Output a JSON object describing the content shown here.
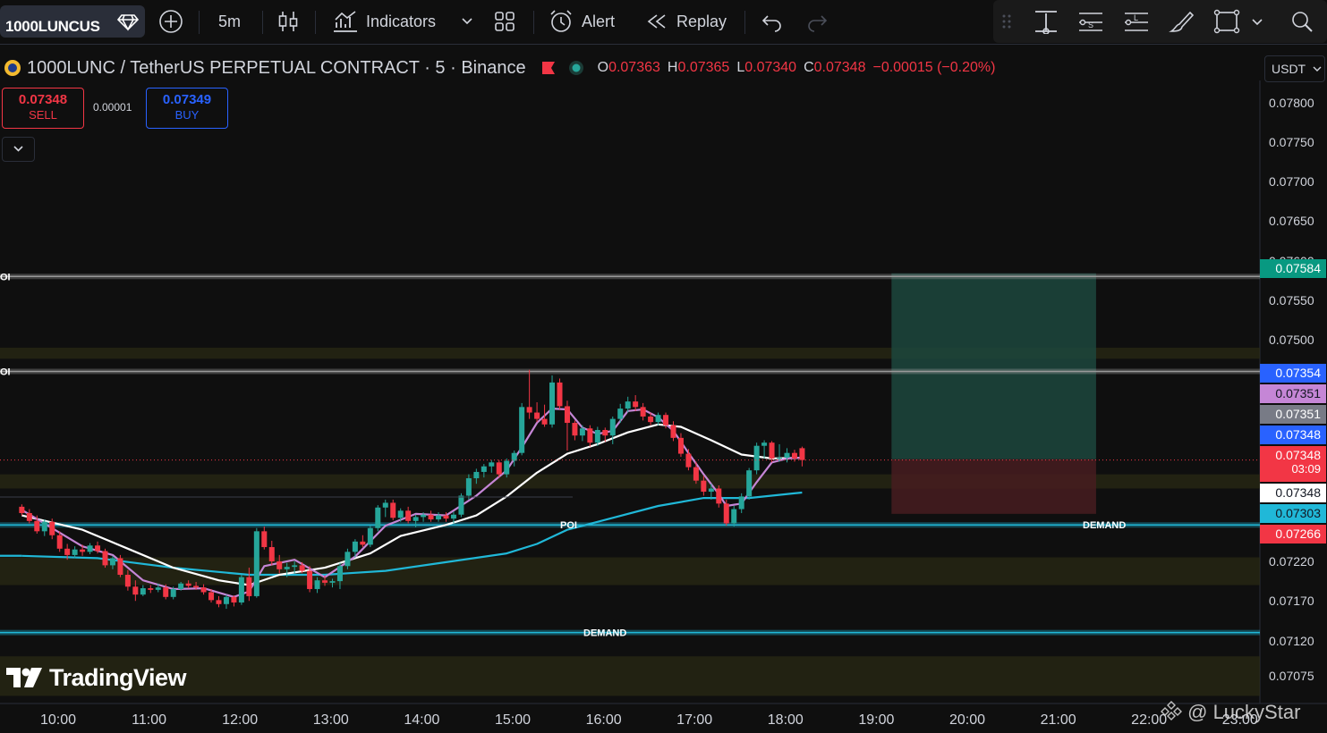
{
  "toolbar": {
    "symbol": "1000LUNCUS",
    "interval": "5m",
    "indicators_label": "Indicators",
    "alert_label": "Alert",
    "replay_label": "Replay"
  },
  "legend": {
    "title": "1000LUNC / TetherUS PERPETUAL CONTRACT · 5 · Binance",
    "open_label": "O",
    "open": "0.07363",
    "high_label": "H",
    "high": "0.07365",
    "low_label": "L",
    "low": "0.07340",
    "close_label": "C",
    "close": "0.07348",
    "change": "−0.00015 (−0.20%)"
  },
  "trade": {
    "sell_price": "0.07348",
    "sell_label": "SELL",
    "spread": "0.00001",
    "buy_price": "0.07349",
    "buy_label": "BUY"
  },
  "currency": "USDT",
  "colors": {
    "up": "#26a69a",
    "down": "#f23645",
    "ema_fast": "#c586d6",
    "ema_slow": "#ffffff",
    "ema_long": "#20b8d8",
    "profit_zone": "#1d4a40",
    "loss_zone": "#4a1d20",
    "zone_fill": "#2a2a14"
  },
  "price_tags": [
    {
      "price": "0.07584",
      "color": "#089981",
      "text_color": "#ffffff"
    },
    {
      "price": "0.07354",
      "color": "#2962ff",
      "text_color": "#ffffff"
    },
    {
      "price": "0.07351",
      "color": "#c586d6",
      "text_color": "#131722"
    },
    {
      "price": "0.07351",
      "color": "#787b86",
      "text_color": "#ffffff"
    },
    {
      "price": "0.07348",
      "color": "#2962ff",
      "text_color": "#ffffff"
    },
    {
      "price": "0.07348",
      "countdown": "03:09",
      "color": "#f23645",
      "text_color": "#ffffff"
    },
    {
      "price": "0.07348",
      "color": "#ffffff",
      "text_color": "#131722"
    },
    {
      "price": "0.07303",
      "color": "#20b8d8",
      "text_color": "#131722"
    },
    {
      "price": "0.07266",
      "color": "#f23645",
      "text_color": "#ffffff"
    }
  ],
  "annotations": {
    "poi_label": "POI",
    "poi_label_short": "OI",
    "demand_label": "DEMAND"
  },
  "watermark": "@ LuckyStar",
  "logo_text": "TradingView",
  "chart_data": {
    "type": "candlestick",
    "title": "1000LUNC / TetherUS PERPETUAL CONTRACT · 5 · Binance",
    "y_ticks": [
      "0.07800",
      "0.07750",
      "0.07700",
      "0.07650",
      "0.07600",
      "0.07550",
      "0.07500",
      "0.07220",
      "0.07170",
      "0.07120",
      "0.07075"
    ],
    "x_ticks": [
      "10:00",
      "11:00",
      "12:00",
      "13:00",
      "14:00",
      "15:00",
      "16:00",
      "17:00",
      "18:00",
      "19:00",
      "20:00",
      "21:00",
      "22:00",
      "23:00"
    ],
    "ylim": [
      0.0705,
      0.0785
    ],
    "xlim": [
      "09:36",
      "23:30"
    ],
    "candles_start": "09:36",
    "candle_interval_minutes": 5,
    "candles": [
      [
        0.07289,
        0.07292,
        0.07278,
        0.07281
      ],
      [
        0.07281,
        0.07286,
        0.07268,
        0.07271
      ],
      [
        0.07271,
        0.07278,
        0.07255,
        0.07258
      ],
      [
        0.07258,
        0.07273,
        0.07252,
        0.0727
      ],
      [
        0.0727,
        0.07274,
        0.07248,
        0.07253
      ],
      [
        0.07253,
        0.07258,
        0.07232,
        0.07236
      ],
      [
        0.07236,
        0.07242,
        0.07222,
        0.07228
      ],
      [
        0.07228,
        0.07239,
        0.07224,
        0.07235
      ],
      [
        0.07235,
        0.07241,
        0.07227,
        0.07232
      ],
      [
        0.07232,
        0.07243,
        0.07229,
        0.0724
      ],
      [
        0.0724,
        0.07245,
        0.0723,
        0.07233
      ],
      [
        0.07233,
        0.07236,
        0.07212,
        0.07215
      ],
      [
        0.07215,
        0.07227,
        0.0721,
        0.07224
      ],
      [
        0.07224,
        0.07228,
        0.072,
        0.07203
      ],
      [
        0.07203,
        0.07209,
        0.07183,
        0.07188
      ],
      [
        0.07188,
        0.07196,
        0.0717,
        0.07178
      ],
      [
        0.07178,
        0.0719,
        0.07176,
        0.07186
      ],
      [
        0.07186,
        0.0719,
        0.0718,
        0.07184
      ],
      [
        0.07184,
        0.07192,
        0.07181,
        0.07187
      ],
      [
        0.07187,
        0.07191,
        0.07172,
        0.07175
      ],
      [
        0.07175,
        0.07188,
        0.07172,
        0.07185
      ],
      [
        0.07185,
        0.07194,
        0.07183,
        0.07192
      ],
      [
        0.07192,
        0.07196,
        0.07186,
        0.07189
      ],
      [
        0.07189,
        0.07194,
        0.07184,
        0.07187
      ],
      [
        0.07187,
        0.07191,
        0.07178,
        0.07181
      ],
      [
        0.07181,
        0.07185,
        0.07168,
        0.07171
      ],
      [
        0.07171,
        0.07176,
        0.07162,
        0.07166
      ],
      [
        0.07166,
        0.07178,
        0.0716,
        0.07175
      ],
      [
        0.07175,
        0.07177,
        0.07163,
        0.07168
      ],
      [
        0.07168,
        0.07203,
        0.07165,
        0.072
      ],
      [
        0.072,
        0.07212,
        0.0717,
        0.07176
      ],
      [
        0.07176,
        0.07262,
        0.07174,
        0.07258
      ],
      [
        0.07258,
        0.07264,
        0.07235,
        0.07238
      ],
      [
        0.07238,
        0.07246,
        0.07215,
        0.0722
      ],
      [
        0.0722,
        0.07228,
        0.07205,
        0.0721
      ],
      [
        0.0721,
        0.07218,
        0.072,
        0.07213
      ],
      [
        0.07213,
        0.0722,
        0.07205,
        0.07215
      ],
      [
        0.07215,
        0.07219,
        0.07205,
        0.07208
      ],
      [
        0.07208,
        0.07214,
        0.07181,
        0.07185
      ],
      [
        0.07185,
        0.072,
        0.0718,
        0.07196
      ],
      [
        0.07196,
        0.07202,
        0.07189,
        0.07193
      ],
      [
        0.07193,
        0.07198,
        0.07187,
        0.07195
      ],
      [
        0.07195,
        0.07218,
        0.07185,
        0.07214
      ],
      [
        0.07214,
        0.07236,
        0.0721,
        0.07232
      ],
      [
        0.07232,
        0.07248,
        0.07225,
        0.07245
      ],
      [
        0.07245,
        0.07253,
        0.07238,
        0.07241
      ],
      [
        0.07241,
        0.07265,
        0.07238,
        0.07262
      ],
      [
        0.07262,
        0.07291,
        0.07258,
        0.07288
      ],
      [
        0.07288,
        0.07298,
        0.07276,
        0.07294
      ],
      [
        0.07294,
        0.07298,
        0.07272,
        0.07275
      ],
      [
        0.07275,
        0.07287,
        0.0727,
        0.07284
      ],
      [
        0.07284,
        0.07289,
        0.07268,
        0.07271
      ],
      [
        0.07271,
        0.07279,
        0.07263,
        0.07276
      ],
      [
        0.07276,
        0.07282,
        0.0727,
        0.07279
      ],
      [
        0.07279,
        0.07284,
        0.0727,
        0.07273
      ],
      [
        0.07273,
        0.07282,
        0.0727,
        0.07278
      ],
      [
        0.07278,
        0.07282,
        0.0727,
        0.07274
      ],
      [
        0.07274,
        0.07283,
        0.07268,
        0.07279
      ],
      [
        0.07279,
        0.07306,
        0.07276,
        0.07303
      ],
      [
        0.07303,
        0.0733,
        0.07298,
        0.07325
      ],
      [
        0.07325,
        0.07337,
        0.07318,
        0.07333
      ],
      [
        0.07333,
        0.07343,
        0.07326,
        0.0734
      ],
      [
        0.0734,
        0.07348,
        0.07332,
        0.07345
      ],
      [
        0.07345,
        0.07348,
        0.07326,
        0.0733
      ],
      [
        0.0733,
        0.0735,
        0.07326,
        0.07347
      ],
      [
        0.07347,
        0.0736,
        0.0734,
        0.07357
      ],
      [
        0.07357,
        0.0742,
        0.07354,
        0.07415
      ],
      [
        0.07415,
        0.07462,
        0.074,
        0.07408
      ],
      [
        0.07408,
        0.07421,
        0.07396,
        0.074
      ],
      [
        0.074,
        0.07418,
        0.0739,
        0.07393
      ],
      [
        0.07393,
        0.07455,
        0.07389,
        0.07446
      ],
      [
        0.07446,
        0.07451,
        0.07412,
        0.07416
      ],
      [
        0.07416,
        0.07423,
        0.0736,
        0.07395
      ],
      [
        0.07395,
        0.07398,
        0.07373,
        0.07379
      ],
      [
        0.07379,
        0.07392,
        0.07372,
        0.07388
      ],
      [
        0.07388,
        0.07392,
        0.07365,
        0.0737
      ],
      [
        0.0737,
        0.0739,
        0.07366,
        0.07386
      ],
      [
        0.07386,
        0.07389,
        0.07371,
        0.07379
      ],
      [
        0.07379,
        0.07403,
        0.07368,
        0.074
      ],
      [
        0.074,
        0.07419,
        0.07395,
        0.07413
      ],
      [
        0.07413,
        0.07428,
        0.07408,
        0.07422
      ],
      [
        0.07422,
        0.0743,
        0.0741,
        0.07415
      ],
      [
        0.07415,
        0.0742,
        0.07398,
        0.07403
      ],
      [
        0.07403,
        0.07408,
        0.07392,
        0.07396
      ],
      [
        0.07396,
        0.07408,
        0.07392,
        0.07405
      ],
      [
        0.07405,
        0.07408,
        0.07388,
        0.07392
      ],
      [
        0.07392,
        0.07397,
        0.07372,
        0.07376
      ],
      [
        0.07376,
        0.07382,
        0.07352,
        0.07356
      ],
      [
        0.07356,
        0.07362,
        0.07335,
        0.07339
      ],
      [
        0.07339,
        0.07346,
        0.07318,
        0.07322
      ],
      [
        0.07322,
        0.07328,
        0.07303,
        0.07308
      ],
      [
        0.07308,
        0.07318,
        0.07298,
        0.07312
      ],
      [
        0.07312,
        0.07316,
        0.07288,
        0.07293
      ],
      [
        0.07293,
        0.07298,
        0.07265,
        0.07268
      ],
      [
        0.07268,
        0.0729,
        0.07264,
        0.07286
      ],
      [
        0.07286,
        0.07306,
        0.07281,
        0.07302
      ],
      [
        0.07302,
        0.07338,
        0.07298,
        0.07335
      ],
      [
        0.07335,
        0.0737,
        0.0733,
        0.07366
      ],
      [
        0.07366,
        0.07373,
        0.0735,
        0.0737
      ],
      [
        0.0737,
        0.07372,
        0.07345,
        0.0735
      ],
      [
        0.0735,
        0.07368,
        0.07346,
        0.07351
      ],
      [
        0.07351,
        0.07363,
        0.07345,
        0.07357
      ],
      [
        0.07357,
        0.07361,
        0.07346,
        0.0735
      ],
      [
        0.07363,
        0.07365,
        0.0734,
        0.07348
      ]
    ],
    "series": [
      {
        "name": "",
        "color": "#c586d6",
        "points": [
          [
            0,
            0.07285
          ],
          [
            4,
            0.07262
          ],
          [
            8,
            0.07239
          ],
          [
            12,
            0.07228
          ],
          [
            16,
            0.07196
          ],
          [
            20,
            0.07185
          ],
          [
            24,
            0.07186
          ],
          [
            28,
            0.07175
          ],
          [
            30,
            0.07182
          ],
          [
            32,
            0.07214
          ],
          [
            36,
            0.07222
          ],
          [
            40,
            0.072
          ],
          [
            44,
            0.07226
          ],
          [
            48,
            0.07265
          ],
          [
            52,
            0.0728
          ],
          [
            56,
            0.07278
          ],
          [
            60,
            0.07303
          ],
          [
            64,
            0.07335
          ],
          [
            66,
            0.07364
          ],
          [
            68,
            0.07395
          ],
          [
            70,
            0.07413
          ],
          [
            72,
            0.07412
          ],
          [
            74,
            0.07389
          ],
          [
            76,
            0.07381
          ],
          [
            78,
            0.07385
          ],
          [
            80,
            0.0741
          ],
          [
            82,
            0.07412
          ],
          [
            84,
            0.07402
          ],
          [
            86,
            0.07385
          ],
          [
            88,
            0.07357
          ],
          [
            90,
            0.0733
          ],
          [
            92,
            0.07305
          ],
          [
            93,
            0.0729
          ],
          [
            95,
            0.07293
          ],
          [
            97,
            0.0732
          ],
          [
            99,
            0.07345
          ],
          [
            101,
            0.0735
          ],
          [
            103,
            0.07351
          ]
        ]
      },
      {
        "name": "",
        "color": "#ffffff",
        "points": [
          [
            0,
            0.07278
          ],
          [
            8,
            0.0726
          ],
          [
            14,
            0.07236
          ],
          [
            20,
            0.07212
          ],
          [
            26,
            0.07196
          ],
          [
            30,
            0.0719
          ],
          [
            34,
            0.07203
          ],
          [
            40,
            0.07212
          ],
          [
            46,
            0.0723
          ],
          [
            50,
            0.07252
          ],
          [
            56,
            0.07266
          ],
          [
            60,
            0.07278
          ],
          [
            64,
            0.07302
          ],
          [
            68,
            0.07332
          ],
          [
            72,
            0.07356
          ],
          [
            76,
            0.07368
          ],
          [
            80,
            0.07383
          ],
          [
            84,
            0.07393
          ],
          [
            87,
            0.0739
          ],
          [
            91,
            0.07373
          ],
          [
            95,
            0.07355
          ],
          [
            99,
            0.0735
          ],
          [
            103,
            0.07351
          ]
        ]
      },
      {
        "name": "",
        "color": "#20b8d8",
        "points": [
          [
            0,
            0.07227
          ],
          [
            10,
            0.07224
          ],
          [
            20,
            0.07212
          ],
          [
            30,
            0.07203
          ],
          [
            40,
            0.07203
          ],
          [
            48,
            0.07208
          ],
          [
            56,
            0.07219
          ],
          [
            64,
            0.0723
          ],
          [
            68,
            0.07242
          ],
          [
            72,
            0.0726
          ],
          [
            78,
            0.07275
          ],
          [
            84,
            0.0729
          ],
          [
            90,
            0.073
          ],
          [
            96,
            0.073
          ],
          [
            103,
            0.07307
          ]
        ]
      }
    ],
    "levels": [
      {
        "type": "POI",
        "price": 0.0758
      },
      {
        "type": "POI",
        "price": 0.0746
      },
      {
        "type": "DEMAND",
        "price": 0.07266
      },
      {
        "type": "DEMAND",
        "price": 0.0713
      }
    ],
    "zones": [
      {
        "top": 0.0749,
        "bottom": 0.07476
      },
      {
        "top": 0.0733,
        "bottom": 0.07312
      },
      {
        "top": 0.07225,
        "bottom": 0.0719
      },
      {
        "top": 0.071,
        "bottom": 0.0705
      }
    ],
    "position": {
      "start": "19:10",
      "end": "21:25",
      "entry": 0.07349,
      "target": 0.07584,
      "stop": 0.0728
    },
    "grid": false,
    "legend": "top-left"
  }
}
